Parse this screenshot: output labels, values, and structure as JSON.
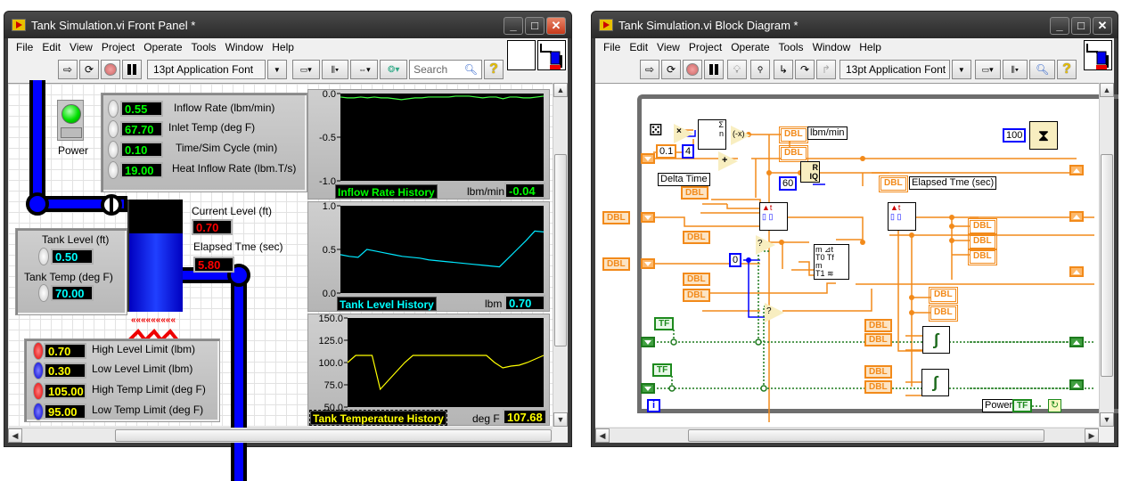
{
  "front_panel": {
    "title": "Tank Simulation.vi Front Panel *",
    "menu": [
      "File",
      "Edit",
      "View",
      "Project",
      "Operate",
      "Tools",
      "Window",
      "Help"
    ],
    "font_selector": "13pt Application Font",
    "search_placeholder": "Search",
    "power": {
      "label": "Power",
      "state": "on",
      "color": "#00e000"
    },
    "inputs": [
      {
        "label": "Inflow Rate (lbm/min)",
        "value": "0.55"
      },
      {
        "label": "Inlet Temp (deg F)",
        "value": "67.70"
      },
      {
        "label": "Time/Sim Cycle (min)",
        "value": "0.10"
      },
      {
        "label": "Heat Inflow Rate (lbm.T/s)",
        "value": "19.00"
      }
    ],
    "tank_init": [
      {
        "label": "Tank Level (ft)",
        "value": "0.50"
      },
      {
        "label": "Tank Temp (deg F)",
        "value": "70.00"
      }
    ],
    "current_level": {
      "label": "Current Level (ft)",
      "value": "0.70"
    },
    "elapsed": {
      "label": "Elapsed Tme (sec)",
      "value": "5.80"
    },
    "limits": [
      {
        "label": "High Level Limit (lbm)",
        "value": "0.70",
        "color": "red"
      },
      {
        "label": "Low Level Limit (lbm)",
        "value": "0.30",
        "color": "blue"
      },
      {
        "label": "High Temp Limit (deg F)",
        "value": "105.00",
        "color": "red"
      },
      {
        "label": "Low Temp Limit (deg F)",
        "value": "95.00",
        "color": "blue"
      }
    ],
    "tank_fill_fraction": 0.7
  },
  "chart_data": [
    {
      "type": "line",
      "title": "Inflow Rate History",
      "unit_label": "lbm/min",
      "readout": "-0.04",
      "color": "#40ff40",
      "ylim": [
        -1.0,
        0.0
      ],
      "yticks": [
        "0.0",
        "-0.5",
        "-1.0"
      ],
      "values": [
        -0.04,
        -0.05,
        -0.05,
        -0.04,
        -0.05,
        -0.04,
        -0.05,
        -0.05,
        -0.06,
        -0.07,
        -0.06,
        -0.05,
        -0.05,
        -0.04,
        -0.04,
        -0.04,
        -0.04,
        -0.03,
        -0.03,
        -0.03,
        -0.04,
        -0.05,
        -0.04,
        -0.04,
        -0.06,
        -0.04,
        -0.04,
        -0.05,
        -0.05,
        -0.04,
        -0.03
      ]
    },
    {
      "type": "line",
      "title": "Tank Level History",
      "unit_label": "lbm",
      "readout": "0.70",
      "color": "#00e8ff",
      "ylim": [
        0.0,
        1.0
      ],
      "yticks": [
        "1.0",
        "0.5",
        "0.0"
      ],
      "values": [
        0.44,
        0.42,
        0.41,
        0.5,
        0.48,
        0.46,
        0.44,
        0.42,
        0.41,
        0.4,
        0.38,
        0.37,
        0.36,
        0.35,
        0.34,
        0.33,
        0.32,
        0.31,
        0.3,
        0.4,
        0.5,
        0.6,
        0.71,
        0.7
      ]
    },
    {
      "type": "line",
      "title": "Tank Temperature History",
      "unit_label": "deg F",
      "readout": "107.68",
      "color": "#ffff00",
      "ylim": [
        50.0,
        150.0
      ],
      "yticks": [
        "150.0",
        "125.0",
        "100.0",
        "75.0",
        "50.0"
      ],
      "values": [
        100,
        108,
        108,
        108,
        70,
        80,
        90,
        100,
        108,
        108,
        108,
        108,
        108,
        108,
        108,
        108,
        108,
        108,
        100,
        94,
        96,
        97,
        100,
        104,
        108
      ]
    }
  ],
  "block_diagram": {
    "title": "Tank Simulation.vi Block Diagram *",
    "menu": [
      "File",
      "Edit",
      "View",
      "Project",
      "Operate",
      "Tools",
      "Window",
      "Help"
    ],
    "font_selector": "13pt Application Font",
    "constants": {
      "multiplier": "0.1",
      "avg_samples": "4",
      "seconds": "60",
      "wait_ms": "100",
      "zero": "0"
    },
    "labels": {
      "lbm_min": "lbm/min",
      "delta_time": "Delta Time",
      "elapsed": "Elapsed Tme (sec)",
      "power": "Power",
      "iteration": "i"
    },
    "dbl": "DBL",
    "tf": "TF"
  }
}
